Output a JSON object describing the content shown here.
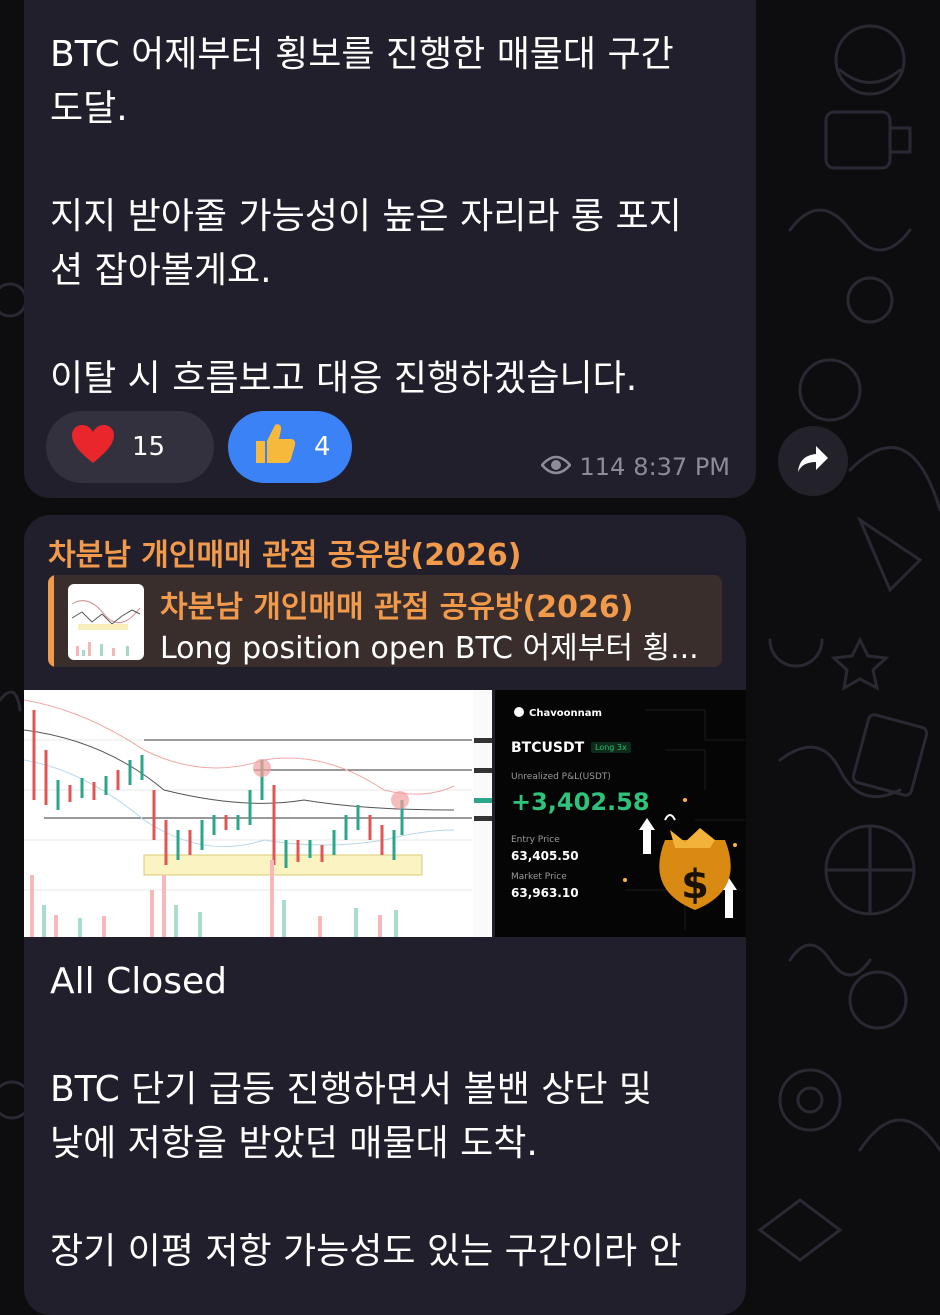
{
  "message1": {
    "text": "BTC 어제부터 횡보를 진행한 매물대 구간\n도달.\n\n지지 받아줄 가능성이 높은 자리라 롱 포지\n션 잡아볼게요.\n\n이탈 시 흐름보고 대응 진행하겠습니다.",
    "reactions": [
      {
        "emoji": "❤️",
        "count": "15",
        "icon": "heart-icon"
      },
      {
        "emoji": "👍",
        "count": "4",
        "icon": "thumbs-up-icon"
      }
    ],
    "views": "114",
    "time": "8:37 PM"
  },
  "message2": {
    "channel": "차분남 개인매매 관점 공유방(2026)",
    "reply": {
      "title": "차분남 개인매매 관점 공유방(2026)",
      "text": "Long position open BTC 어제부터 횡..."
    },
    "card": {
      "brand": "Chavoonnam",
      "symbol": "BTCUSDT",
      "leverage": "Long 3x",
      "pnl_label": "Unrealized P&L(USDT)",
      "pnl": "+3,402.58",
      "entry_label": "Entry Price",
      "entry": "63,405.50",
      "market_label": "Market Price",
      "market": "63,963.10"
    },
    "text": "All Closed\n\nBTC 단기 급등 진행하면서 볼밴 상단 및\n낮에 저항을 받았던 매물대 도착.\n\n장기 이평 저항 가능성도 있는 구간이라 안"
  },
  "colors": {
    "bubble": "#211f2b",
    "accent": "#f19a4b",
    "like": "#3b82f6",
    "profit": "#2fc27a"
  }
}
